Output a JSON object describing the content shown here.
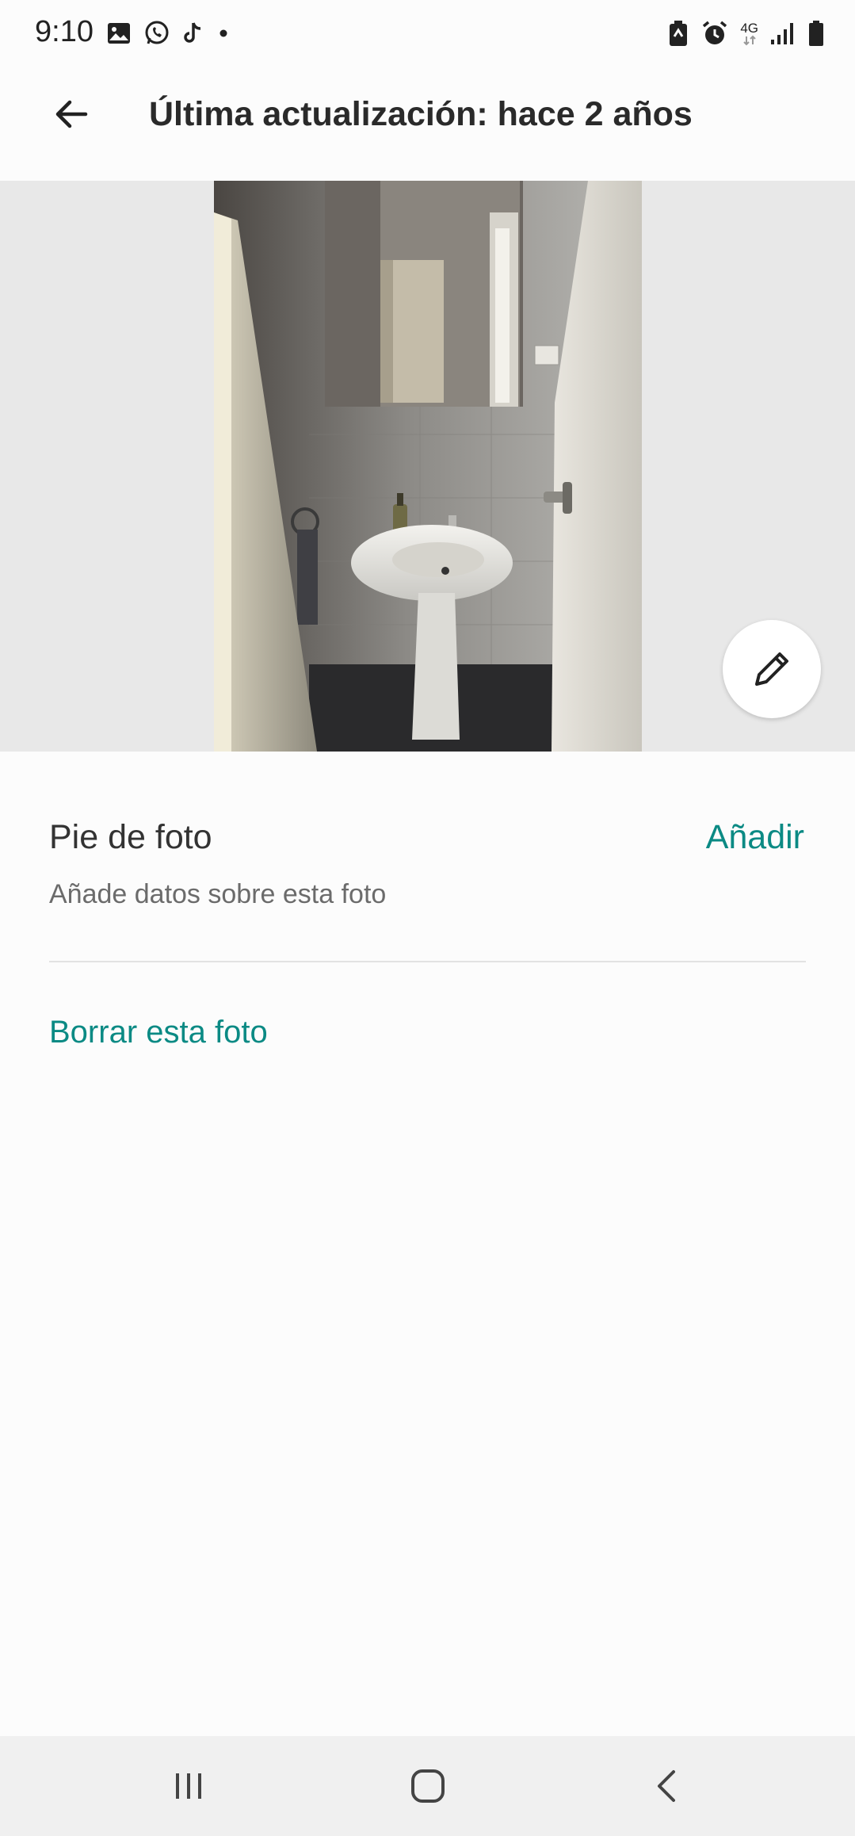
{
  "status_bar": {
    "time": "9:10",
    "network": "4G",
    "icons_left": [
      "image-icon",
      "whatsapp-icon",
      "tiktok-icon",
      "dot-icon"
    ],
    "icons_right": [
      "battery-saver-icon",
      "alarm-icon",
      "network-4g-icon",
      "signal-icon",
      "battery-icon"
    ]
  },
  "app_bar": {
    "back_icon": "arrow-left-icon",
    "title": "Última actualización: hace 2 años"
  },
  "photo": {
    "edit_icon": "pencil-icon"
  },
  "caption": {
    "label": "Pie de foto",
    "add_label": "Añadir",
    "hint": "Añade datos sobre esta foto"
  },
  "actions": {
    "delete_label": "Borrar esta foto"
  },
  "nav_bar": {
    "icons": [
      "recent-apps-icon",
      "home-icon",
      "back-icon"
    ]
  },
  "colors": {
    "accent": "#0b8a84",
    "background": "#fcfcfc",
    "photo_band": "#e8e8e8",
    "nav_bar": "#f0f0f0"
  }
}
